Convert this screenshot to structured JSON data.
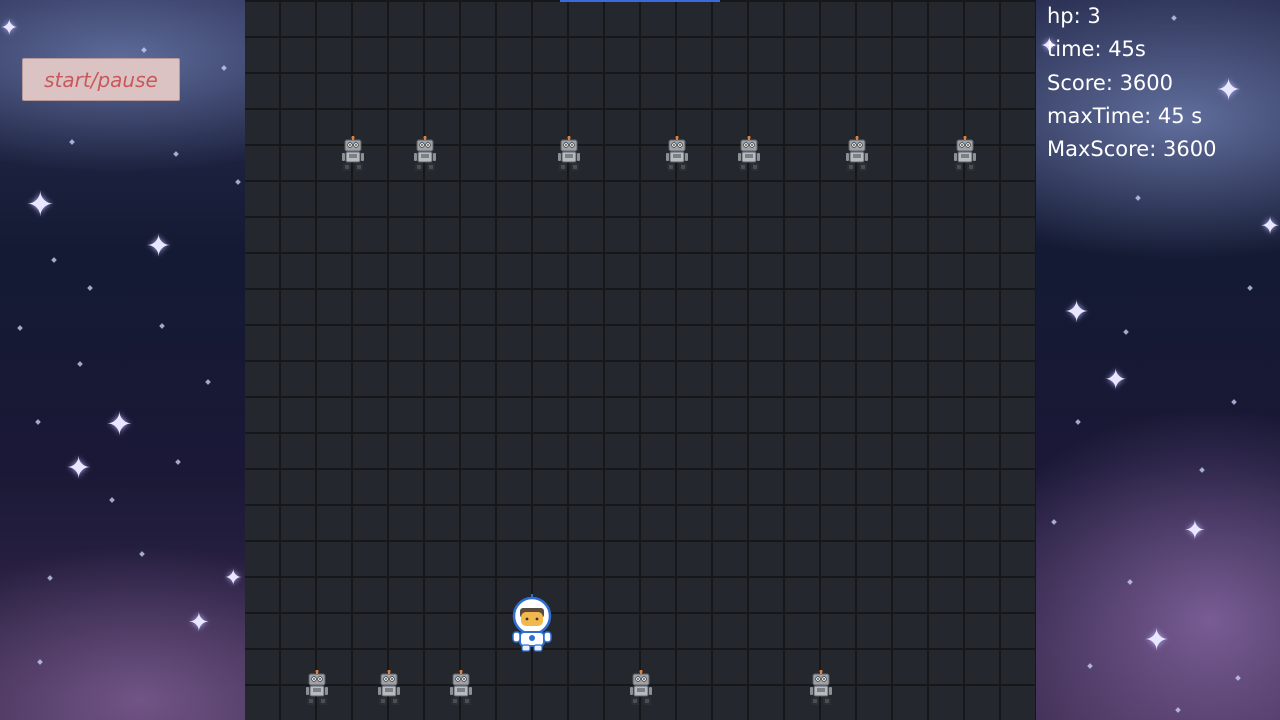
{
  "controls": {
    "start_pause_label": "start/pause"
  },
  "hud": {
    "hp": "hp: 3",
    "time": "time: 45s",
    "score": "Score: 3600",
    "max_time": "maxTime: 45 s",
    "max_score": "MaxScore: 3600"
  },
  "sprites": {
    "enemy": "robot-enemy-icon",
    "player": "astronaut-player-icon"
  },
  "colors": {
    "button_bg": "#dcc3c3",
    "button_text": "#c8585c",
    "hud_text": "#ffffff",
    "board_bg": "#24272e"
  }
}
